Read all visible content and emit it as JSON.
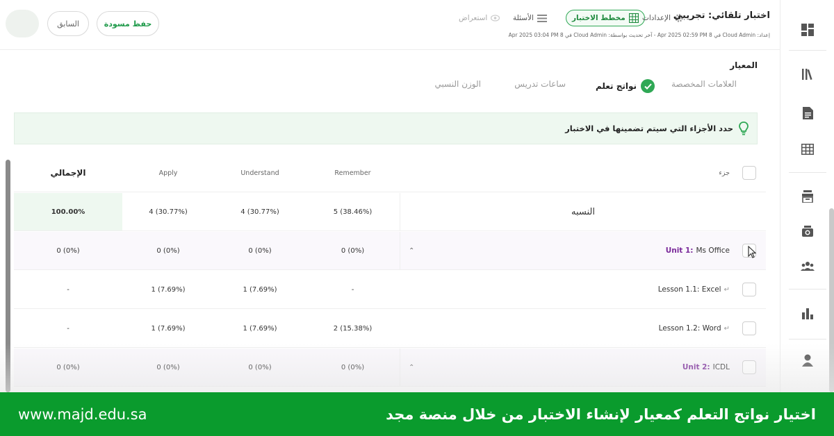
{
  "header": {
    "quiz_title": "اختبار تلقائي: تجريبي",
    "meta": "إعداد: Cloud Admin في 8 Apr 2025 02:59 PM - آخر تحديث بواسطة: Cloud Admin في 8 Apr 2025 03:04 PM",
    "prev_label": "السابق",
    "draft_label": "حفظ مسودة",
    "steps": {
      "settings": "الإعدادات",
      "plan": "مخطط الاختبار",
      "questions": "الأسئلة",
      "preview": "استعراض"
    }
  },
  "criteria": {
    "title": "المعيار",
    "tabs": {
      "custom": "العلامات المخصصة",
      "outcomes": "نواتج تعلم",
      "hours": "ساعات تدريس",
      "weight": "الوزن النسبي"
    },
    "hint": "حدد الأجزاء التي سيتم تضمينها في الاختبار"
  },
  "table": {
    "headers": {
      "part": "جزء",
      "remember": "Remember",
      "understand": "Understand",
      "apply": "Apply",
      "total": "الإجمالي"
    },
    "ratio": {
      "label": "النسبه",
      "remember": "5 (38.46%)",
      "understand": "4 (30.77%)",
      "apply": "4 (30.77%)",
      "total": "100.00%"
    },
    "rows": [
      {
        "prefix": "Unit 1:",
        "name": "Ms Office",
        "remember": "0 (0%)",
        "understand": "0 (0%)",
        "apply": "0 (0%)",
        "total": "0 (0%)"
      },
      {
        "name": "Lesson 1.1: Excel",
        "remember": "-",
        "understand": "1 (7.69%)",
        "apply": "1 (7.69%)",
        "total": "-"
      },
      {
        "name": "Lesson 1.2: Word",
        "remember": "2 (15.38%)",
        "understand": "1 (7.69%)",
        "apply": "1 (7.69%)",
        "total": "-"
      },
      {
        "prefix": "Unit 2:",
        "name": "ICDL",
        "remember": "0 (0%)",
        "understand": "0 (0%)",
        "apply": "0 (0%)",
        "total": "0 (0%)"
      }
    ]
  },
  "banner": {
    "url": "www.majd.edu.sa",
    "title": "اختيار نواتج التعلم كمعيار لإنشاء الاختبار من خلال منصة مجد"
  },
  "colors": {
    "accent_green": "#2fa855",
    "banner_green": "#0a9b2d",
    "unit_purple": "#7a2a9a"
  },
  "icons": [
    "dashboard-icon",
    "library-icon",
    "document-icon",
    "table-icon",
    "archive-icon",
    "camera-icon",
    "group-icon",
    "bar-chart-icon",
    "user-icon",
    "gear-icon",
    "list-icon",
    "eye-icon",
    "check-icon",
    "lightbulb-icon",
    "cursor-icon"
  ]
}
